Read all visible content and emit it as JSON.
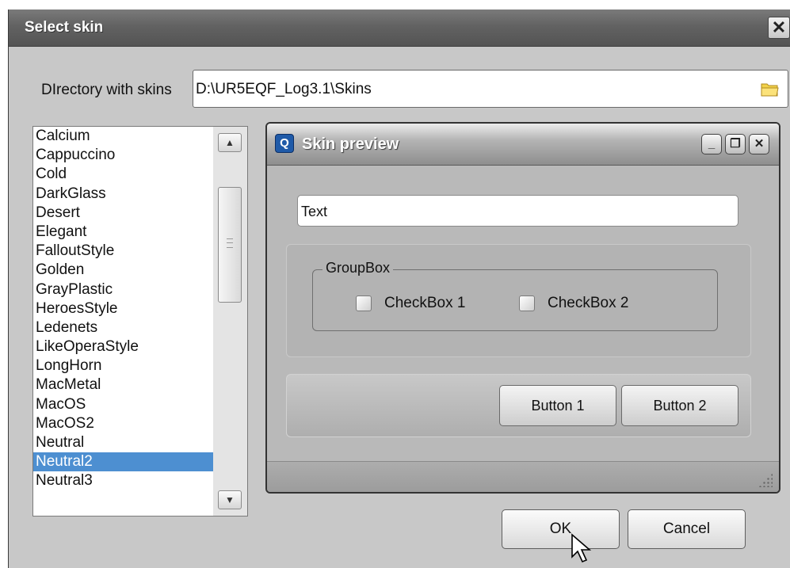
{
  "dialog": {
    "title": "Select skin",
    "close_glyph": "✕",
    "directory_label": "DIrectory with skins",
    "directory_value": "D:\\UR5EQF_Log3.1\\Skins",
    "folder_icon": "folder-icon",
    "ok_label": "OK",
    "cancel_label": "Cancel"
  },
  "skins": [
    "Calcium",
    "Cappuccino",
    "Cold",
    "DarkGlass",
    "Desert",
    "Elegant",
    "FalloutStyle",
    "Golden",
    "GrayPlastic",
    "HeroesStyle",
    "Ledenets",
    "LikeOperaStyle",
    "LongHorn",
    "MacMetal",
    "MacOS",
    "MacOS2",
    "Neutral",
    "Neutral2",
    "Neutral3"
  ],
  "selected_skin": "Neutral2",
  "scroll": {
    "up_glyph": "▲",
    "down_glyph": "▼"
  },
  "preview": {
    "title": "Skin preview",
    "app_icon_letter": "Q",
    "min_glyph": "_",
    "restore_glyph": "❐",
    "close_glyph": "✕",
    "text_value": "Text",
    "groupbox_title": "GroupBox",
    "checkbox1": "CheckBox 1",
    "checkbox2": "CheckBox 2",
    "button1": "Button 1",
    "button2": "Button 2"
  },
  "colors": {
    "selection": "#4d8fd1",
    "titlebar": "#626262",
    "preview_app_icon": "#1f5aa8"
  }
}
